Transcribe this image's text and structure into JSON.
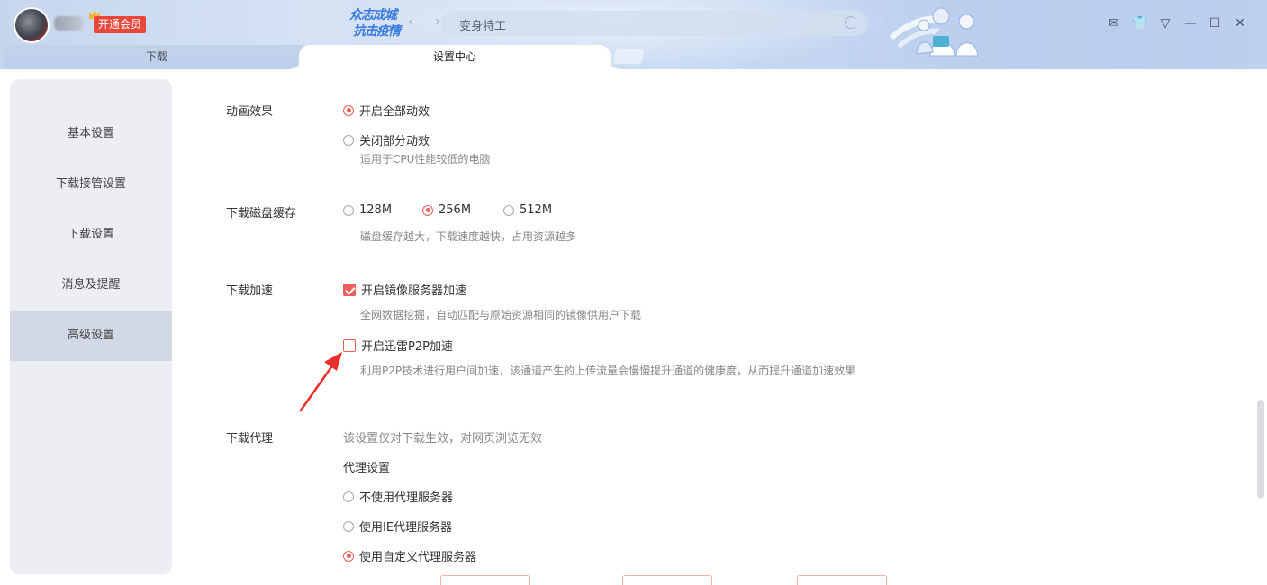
{
  "header": {
    "vip_label": "开通会员",
    "slogan_line1": "众志成城",
    "slogan_line2": "抗击疫情",
    "back_glyph": "‹",
    "forward_glyph": "›",
    "address_text": "变身特工",
    "controls": {
      "mail": "✉",
      "skin": "👕",
      "menu": "▽",
      "minimize": "—",
      "maximize": "☐",
      "close": "✕"
    }
  },
  "tabs": [
    {
      "label": "下载"
    },
    {
      "label": "设置中心"
    }
  ],
  "sidebar": {
    "items": [
      {
        "label": "基本设置"
      },
      {
        "label": "下载接管设置"
      },
      {
        "label": "下载设置"
      },
      {
        "label": "消息及提醒"
      },
      {
        "label": "高级设置",
        "active": true
      }
    ]
  },
  "settings": {
    "animation": {
      "label": "动画效果",
      "opt_all": "开启全部动效",
      "opt_partial": "关闭部分动效",
      "partial_hint": "适用于CPU性能较低的电脑",
      "selected": "opt_all"
    },
    "disk_cache": {
      "label": "下载磁盘缓存",
      "options": [
        "128M",
        "256M",
        "512M"
      ],
      "selected": "256M",
      "hint": "磁盘缓存越大，下载速度越快，占用资源越多"
    },
    "acceleration": {
      "label": "下载加速",
      "mirror_label": "开启镜像服务器加速",
      "mirror_checked": true,
      "mirror_hint": "全网数据挖掘，自动匹配与原始资源相同的镜像供用户下载",
      "p2p_label": "开启迅雷P2P加速",
      "p2p_checked": false,
      "p2p_hint": "利用P2P技术进行用户间加速，该通道产生的上传流量会慢慢提升通道的健康度，从而提升通道加速效果"
    },
    "proxy": {
      "label": "下载代理",
      "hint": "该设置仅对下载生效，对网页浏览无效",
      "settings_label": "代理设置",
      "opt_none": "不使用代理服务器",
      "opt_ie": "使用IE代理服务器",
      "opt_custom": "使用自定义代理服务器",
      "selected": "opt_custom"
    }
  },
  "colors": {
    "accent": "#e9605a",
    "vip": "#e8473a",
    "sidebar_bg": "#eceef4",
    "sidebar_active": "#d3d8e6",
    "titlebar": "#c9daf2"
  }
}
